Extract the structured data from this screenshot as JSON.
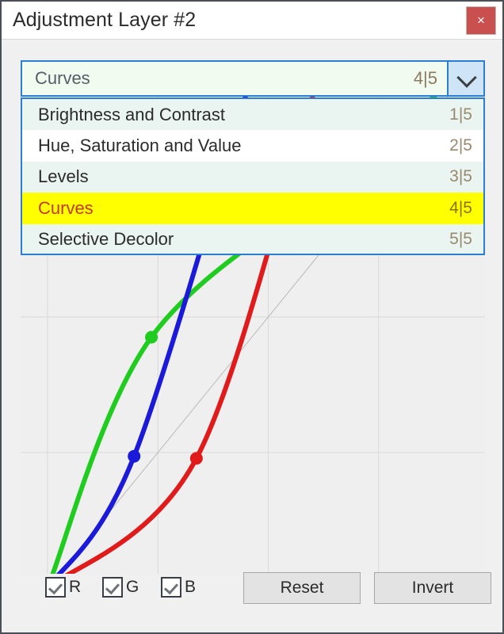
{
  "window": {
    "title": "Adjustment Layer #2",
    "close_label": "×",
    "close_icon": "close-icon",
    "border_color": "#4a4f55"
  },
  "combobox": {
    "selected_label": "Curves",
    "selected_count": "4|5",
    "arrow_icon": "chevron-down-icon",
    "accent_color": "#2a7fd4",
    "field_bg": "#f1fbf0",
    "expanded": true,
    "options": [
      {
        "label": "Brightness and Contrast",
        "count": "1|5",
        "selected": false
      },
      {
        "label": "Hue, Saturation and Value",
        "count": "2|5",
        "selected": false
      },
      {
        "label": "Levels",
        "count": "3|5",
        "selected": false
      },
      {
        "label": "Curves",
        "count": "4|5",
        "selected": true
      },
      {
        "label": "Selective Decolor",
        "count": "5|5",
        "selected": false
      }
    ],
    "highlight_color": "#ffff00",
    "highlight_text_color": "#c43a16"
  },
  "channels": [
    {
      "label": "R",
      "checked": true,
      "color": "#ff0000"
    },
    {
      "label": "G",
      "checked": true,
      "color": "#00cc22"
    },
    {
      "label": "B",
      "checked": true,
      "color": "#1a1ad8"
    }
  ],
  "buttons": {
    "reset": "Reset",
    "invert": "Invert"
  },
  "chart_data": {
    "type": "line",
    "title": "",
    "xlabel": "",
    "ylabel": "",
    "xlim": [
      0,
      255
    ],
    "ylim": [
      0,
      255
    ],
    "grid": true,
    "grid_divisions": 4,
    "background": "#efefef",
    "identity_line": true,
    "identity_color": "#b9b9b9",
    "series": [
      {
        "name": "Red",
        "color": "#e01b1b",
        "points": [
          {
            "x": 0,
            "y": 0
          },
          {
            "x": 86,
            "y": 61
          },
          {
            "x": 158,
            "y": 243
          },
          {
            "x": 175,
            "y": 255
          }
        ],
        "control_points": [
          {
            "x": 0,
            "y": 0
          },
          {
            "x": 86,
            "y": 61
          },
          {
            "x": 158,
            "y": 243
          }
        ]
      },
      {
        "name": "Green",
        "color": "#20cc20",
        "points": [
          {
            "x": 0,
            "y": 0
          },
          {
            "x": 60,
            "y": 118
          },
          {
            "x": 175,
            "y": 196
          },
          {
            "x": 255,
            "y": 255
          }
        ],
        "control_points": [
          {
            "x": 0,
            "y": 0
          },
          {
            "x": 60,
            "y": 118
          },
          {
            "x": 175,
            "y": 196
          }
        ]
      },
      {
        "name": "Blue",
        "color": "#1a1ad8",
        "points": [
          {
            "x": 0,
            "y": 0
          },
          {
            "x": 50,
            "y": 62
          },
          {
            "x": 123,
            "y": 255
          }
        ],
        "control_points": [
          {
            "x": 0,
            "y": 0
          },
          {
            "x": 50,
            "y": 62
          }
        ]
      }
    ]
  }
}
